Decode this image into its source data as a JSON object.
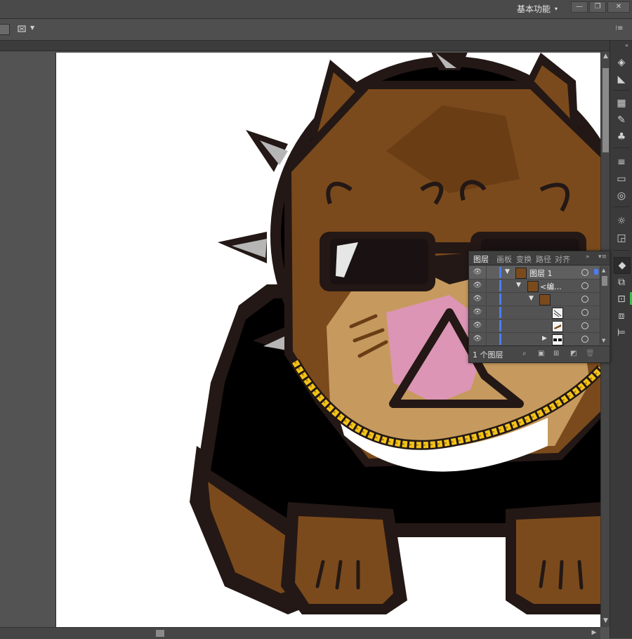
{
  "menubar": {
    "workspace_label": "基本功能",
    "minimize": "—",
    "restore": "❐",
    "close": "✕"
  },
  "controlbar": {
    "tool_icon": "quick-mask-icon",
    "menu_icon": "panel-menu-icon"
  },
  "layers_panel": {
    "tabs": [
      "图层",
      "画板",
      "变换",
      "路径",
      "对齐"
    ],
    "active_tab": "图层",
    "rows": [
      {
        "name": "图层 1",
        "indent": 0,
        "expanded": true
      },
      {
        "name": "<编...",
        "indent": 1,
        "expanded": true
      },
      {
        "name": "",
        "indent": 2,
        "expanded": true
      },
      {
        "name": "",
        "indent": 3,
        "expanded": false
      },
      {
        "name": "",
        "indent": 3,
        "expanded": false
      },
      {
        "name": "",
        "indent": 3,
        "expanded": false
      }
    ],
    "footer_label": "1 个图层"
  },
  "colors": {
    "chrome_dark": "#3a3a3a",
    "chrome_mid": "#535353",
    "layer_color": "#4d7cf4",
    "dog_brown": "#7b4a1c",
    "dog_tan": "#c69a5e",
    "outline": "#231815",
    "chain_gold": "#f2c318",
    "nose_pink": "#dc95b4",
    "spike_gray": "#b6b6b6"
  }
}
